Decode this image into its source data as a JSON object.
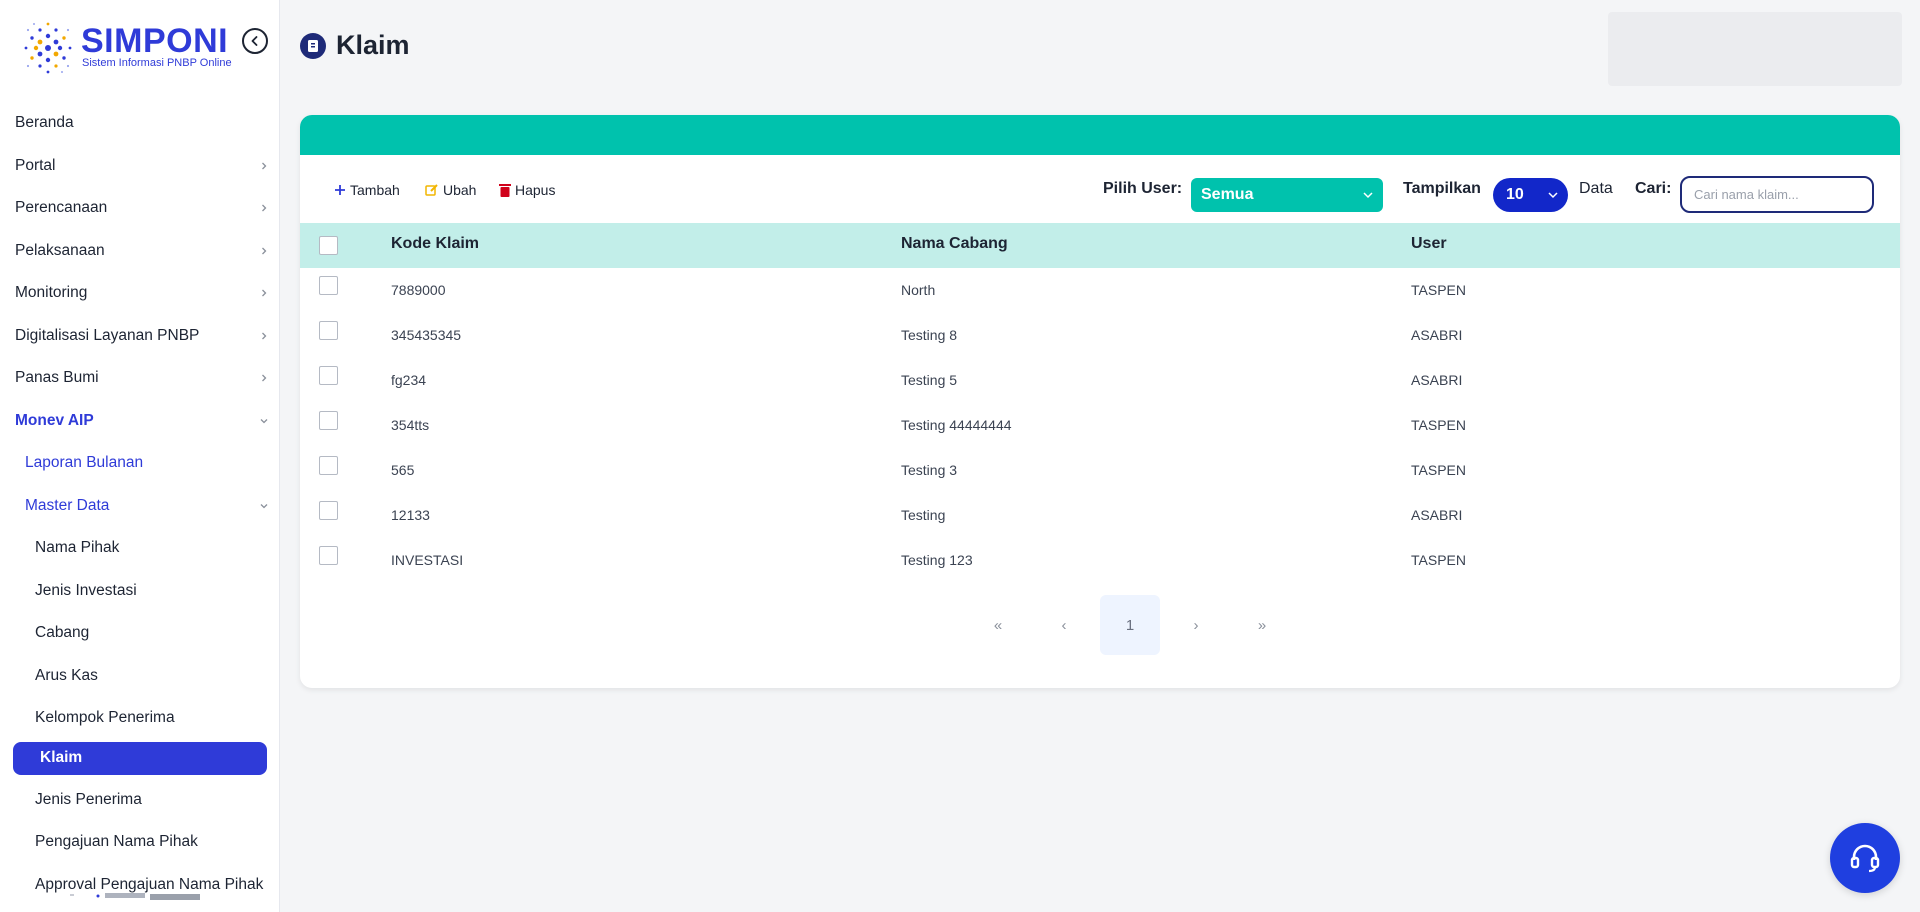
{
  "brand": {
    "name": "SIMPONI",
    "subtitle": "Sistem Informasi PNBP Online"
  },
  "sidebar": {
    "items": [
      {
        "label": "Beranda"
      },
      {
        "label": "Portal"
      },
      {
        "label": "Perencanaan"
      },
      {
        "label": "Pelaksanaan"
      },
      {
        "label": "Monitoring"
      },
      {
        "label": "Digitalisasi Layanan PNBP"
      },
      {
        "label": "Panas Bumi"
      },
      {
        "label": "Monev AIP"
      }
    ],
    "monev": {
      "laporan_bulanan": "Laporan Bulanan",
      "master_data": "Master Data",
      "sub": [
        {
          "label": "Nama Pihak"
        },
        {
          "label": "Jenis Investasi"
        },
        {
          "label": "Cabang"
        },
        {
          "label": "Arus Kas"
        },
        {
          "label": "Kelompok Penerima"
        },
        {
          "label": "Klaim"
        },
        {
          "label": "Jenis Penerima"
        },
        {
          "label": "Pengajuan Nama Pihak"
        },
        {
          "label": "Approval Pengajuan Nama Pihak"
        }
      ]
    }
  },
  "page": {
    "title": "Klaim"
  },
  "toolbar": {
    "add_label": "Tambah",
    "edit_label": "Ubah",
    "delete_label": "Hapus",
    "user_label": "Pilih User:",
    "user_value": "Semua",
    "show_label": "Tampilkan",
    "show_value": "10",
    "data_label": "Data",
    "search_label": "Cari:",
    "search_placeholder": "Cari nama klaim..."
  },
  "table": {
    "headers": [
      "Kode Klaim",
      "Nama Cabang",
      "User"
    ],
    "rows": [
      [
        "7889000",
        "North",
        "TASPEN"
      ],
      [
        "345435345",
        "Testing 8",
        "ASABRI"
      ],
      [
        "fg234",
        "Testing 5",
        "ASABRI"
      ],
      [
        "354tts",
        "Testing 44444444",
        "TASPEN"
      ],
      [
        "565",
        "Testing 3",
        "TASPEN"
      ],
      [
        "12133",
        "Testing",
        "ASABRI"
      ],
      [
        "INVESTASI",
        "Testing 123",
        "TASPEN"
      ]
    ]
  },
  "pagination": {
    "first": "«",
    "prev": "‹",
    "current": "1",
    "next": "›",
    "last": "»"
  },
  "colors": {
    "primary": "#2f3bd8",
    "teal": "#00c2ad",
    "teal_light": "#c2eee9",
    "navy": "#1e2a78"
  },
  "icons": [
    "chevron-left-icon",
    "chevron-right-icon",
    "chevron-down-icon",
    "plus-icon",
    "edit-icon",
    "trash-icon",
    "document-icon",
    "headset-icon"
  ]
}
